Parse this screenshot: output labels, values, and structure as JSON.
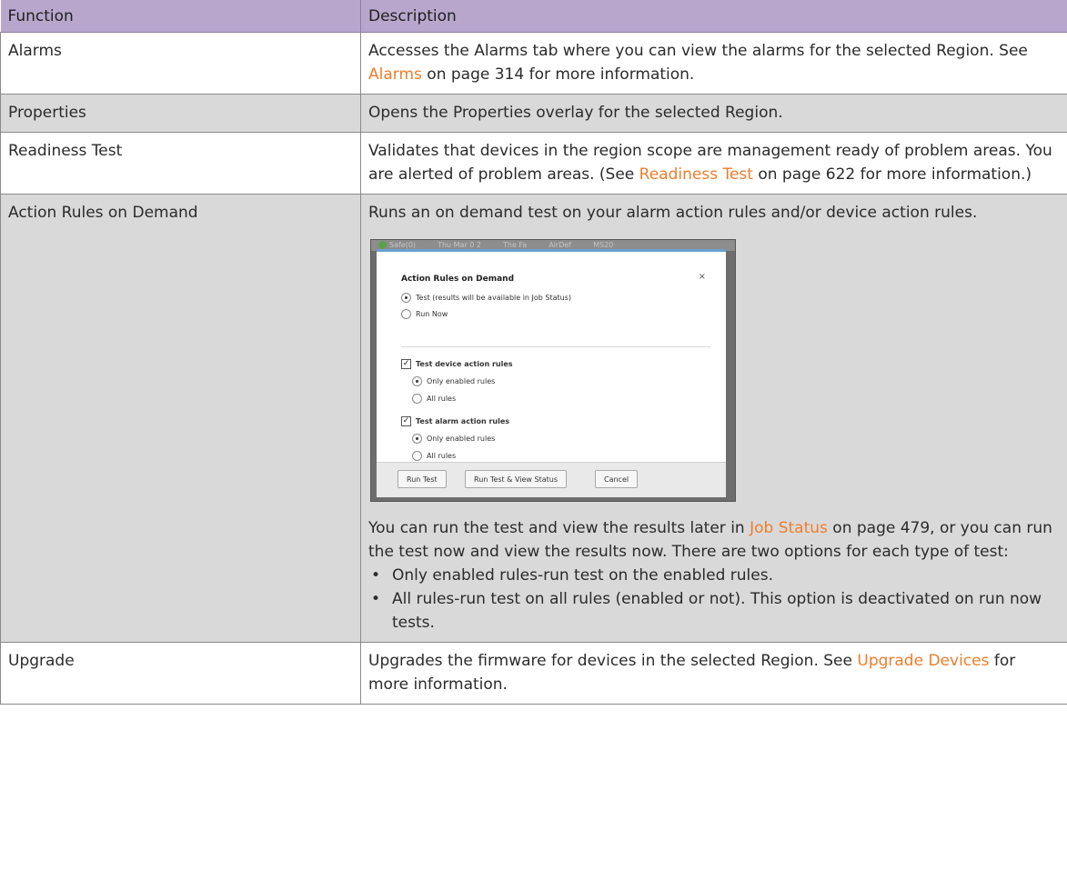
{
  "table": {
    "headers": [
      "Function",
      "Description"
    ],
    "rows": {
      "alarms": {
        "function": "Alarms",
        "desc_a": "Accesses the Alarms tab where you can view the alarms for the selected Region. See ",
        "link": "Alarms",
        "desc_b": " on page 314 for more information."
      },
      "properties": {
        "function": "Properties",
        "desc": "Opens the Properties overlay for the selected Region."
      },
      "readiness": {
        "function": "Readiness Test",
        "desc_a": "Validates that devices in the region scope are management ready of problem areas. You are alerted of problem areas. (See ",
        "link": "Readiness Test",
        "desc_b": " on page 622 for more information.)"
      },
      "action_rules": {
        "function": "Action Rules on Demand",
        "intro": "Runs an on demand test on your alarm action rules and/or device action rules.",
        "para_a": "You can run the test and view the results later in ",
        "link": "Job Status",
        "para_b": " on page 479, or you can run the test now and view the results now. There are two options for each type of test:",
        "bullets": [
          "Only enabled rules-run test on the enabled rules.",
          "All rules-run test on all rules (enabled or not). This option is deactivated on run now tests."
        ]
      },
      "upgrade": {
        "function": "Upgrade",
        "desc_a": "Upgrades the firmware for devices in the selected Region. See ",
        "link": "Upgrade Devices",
        "desc_b": " for more information."
      }
    }
  },
  "dialog": {
    "background_tabs": [
      "Safe(0)",
      "Thu Mar 0 2",
      "The Fa",
      "AirDef",
      "MS20"
    ],
    "title": "Action Rules on Demand",
    "close": "×",
    "mode_test": "Test (results will be available in Job Status)",
    "mode_run_now": "Run Now",
    "device_rules_label": "Test device action rules",
    "alarm_rules_label": "Test alarm action rules",
    "only_enabled": "Only enabled rules",
    "all_rules": "All rules",
    "buttons": {
      "run_test": "Run Test",
      "run_view": "Run Test & View Status",
      "cancel": "Cancel"
    }
  },
  "colors": {
    "header_bg": "#b9a6cd",
    "link": "#ef7d2b",
    "shade_row": "#d9d9d9"
  }
}
